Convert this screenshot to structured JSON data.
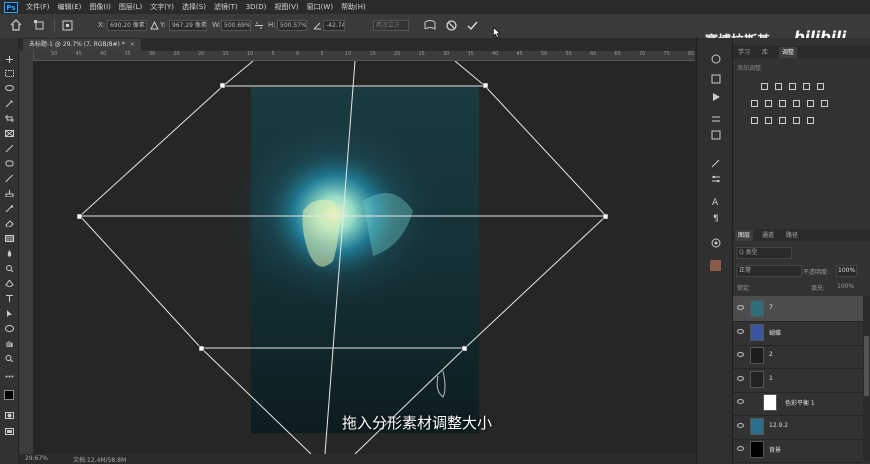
{
  "menu": {
    "logo": "Ps",
    "items": [
      "文件(F)",
      "编辑(E)",
      "图像(I)",
      "图层(L)",
      "文字(Y)",
      "选择(S)",
      "滤镜(T)",
      "3D(D)",
      "视图(V)",
      "窗口(W)",
      "帮助(H)"
    ]
  },
  "options": {
    "x_label": "X:",
    "x_value": "690.20 像素",
    "y_label": "Y:",
    "y_value": "967.29 像素",
    "w_label": "W:",
    "w_value": "500.69%",
    "h_label": "H:",
    "h_value": "500.57%",
    "angle_value": "-42.74",
    "interp_value": "两次立方"
  },
  "watermark": {
    "text": "赛博拉斯基",
    "logo": "bilibili"
  },
  "document": {
    "tab_label": "未标题-1 @ 29.7% (7, RGB/8#) *"
  },
  "ruler": {
    "top_ticks": [
      "50",
      "45",
      "40",
      "35",
      "30",
      "25",
      "20",
      "15",
      "10",
      "5",
      "0",
      "5",
      "10",
      "15",
      "20",
      "25",
      "30",
      "35",
      "40",
      "45",
      "50",
      "55",
      "60",
      "65",
      "70",
      "75",
      "80"
    ]
  },
  "status": {
    "zoom": "29.67%",
    "doc": "文档:12.4M/58.8M"
  },
  "subtitle": "拖入分形素材调整大小",
  "top_panel": {
    "tabs": [
      "学习",
      "库",
      "调整"
    ],
    "active_tab": "调整",
    "header": "添加调整"
  },
  "layers_panel": {
    "tabs": [
      "图层",
      "通道",
      "路径"
    ],
    "active_tab": "图层",
    "kind_label": "Q 类型",
    "blend_mode": "正常",
    "opacity_label": "不透明度:",
    "opacity_value": "100%",
    "lock_label": "锁定:",
    "fill_label": "填充:",
    "fill_value": "100%",
    "layers": [
      {
        "name": "7",
        "selected": true
      },
      {
        "name": "蝴蝶",
        "selected": false
      },
      {
        "name": "2",
        "selected": false
      },
      {
        "name": "1",
        "selected": false
      },
      {
        "name": "色彩平衡 1",
        "selected": false
      },
      {
        "name": "12.9.2",
        "selected": false
      },
      {
        "name": "背景",
        "selected": false
      }
    ]
  },
  "colors": {
    "accent": "#31a8ff",
    "canvas_bg": "#262626",
    "panel_bg": "#323232"
  }
}
